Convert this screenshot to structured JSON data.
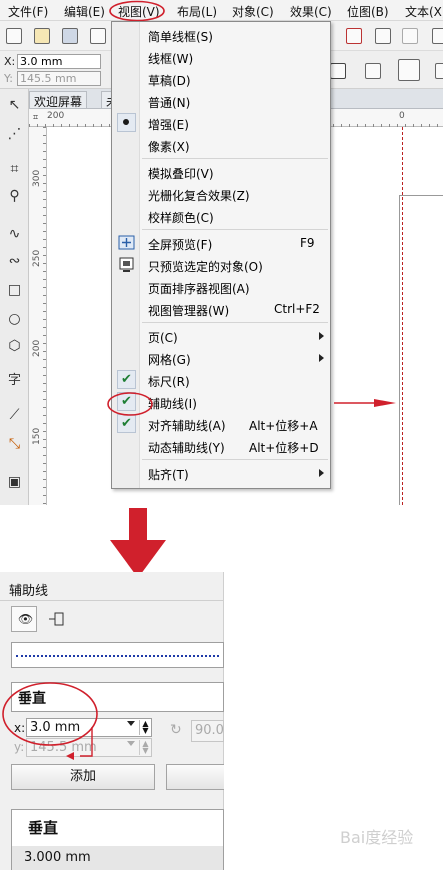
{
  "menubar": {
    "items": [
      "文件(F)",
      "编辑(E)",
      "视图(V)",
      "布局(L)",
      "对象(C)",
      "效果(C)",
      "位图(B)",
      "文本(X)"
    ]
  },
  "property_bar": {
    "x_label": "X:",
    "x_value": "3.0 mm",
    "y_label": "Y:",
    "y_value": "145.5 mm"
  },
  "tabs": {
    "welcome": "欢迎屏幕",
    "untitled": "未"
  },
  "ruler": {
    "h_labels": [
      "200",
      "0"
    ],
    "v_labels": [
      "300",
      "250",
      "200",
      "150"
    ]
  },
  "toolbox": {
    "text_tool": "字"
  },
  "view_menu": {
    "items": [
      {
        "label": "简单线框(S)",
        "shortcut": "",
        "submenu": false,
        "mark": "none"
      },
      {
        "label": "线框(W)",
        "shortcut": "",
        "submenu": false,
        "mark": "none"
      },
      {
        "label": "草稿(D)",
        "shortcut": "",
        "submenu": false,
        "mark": "none"
      },
      {
        "label": "普通(N)",
        "shortcut": "",
        "submenu": false,
        "mark": "none"
      },
      {
        "label": "增强(E)",
        "shortcut": "",
        "submenu": false,
        "mark": "radio"
      },
      {
        "label": "像素(X)",
        "shortcut": "",
        "submenu": false,
        "mark": "none"
      },
      {
        "label": "模拟叠印(V)",
        "shortcut": "",
        "submenu": false,
        "mark": "none"
      },
      {
        "label": "光栅化复合效果(Z)",
        "shortcut": "",
        "submenu": false,
        "mark": "none"
      },
      {
        "label": "校样颜色(C)",
        "shortcut": "",
        "submenu": false,
        "mark": "none"
      },
      {
        "label": "全屏预览(F)",
        "shortcut": "F9",
        "submenu": false,
        "mark": "icon"
      },
      {
        "label": "只预览选定的对象(O)",
        "shortcut": "",
        "submenu": false,
        "mark": "icon"
      },
      {
        "label": "页面排序器视图(A)",
        "shortcut": "",
        "submenu": false,
        "mark": "none"
      },
      {
        "label": "视图管理器(W)",
        "shortcut": "Ctrl+F2",
        "submenu": false,
        "mark": "none"
      },
      {
        "label": "页(C)",
        "shortcut": "",
        "submenu": true,
        "mark": "none"
      },
      {
        "label": "网格(G)",
        "shortcut": "",
        "submenu": true,
        "mark": "none"
      },
      {
        "label": "标尺(R)",
        "shortcut": "",
        "submenu": false,
        "mark": "check"
      },
      {
        "label": "辅助线(I)",
        "shortcut": "",
        "submenu": false,
        "mark": "check"
      },
      {
        "label": "对齐辅助线(A)",
        "shortcut": "Alt+位移+A",
        "submenu": false,
        "mark": "check"
      },
      {
        "label": "动态辅助线(Y)",
        "shortcut": "Alt+位移+D",
        "submenu": false,
        "mark": "none"
      },
      {
        "label": "贴齐(T)",
        "shortcut": "",
        "submenu": true,
        "mark": "none"
      }
    ]
  },
  "guides_panel": {
    "title": "辅助线",
    "orientation_value": "垂直",
    "x_label": "x:",
    "x_value": "3.0 mm",
    "y_label": "y:",
    "y_value": "145.5 mm",
    "angle_value": "90.0",
    "add_button": "添加",
    "list_header": "垂直",
    "list_value": "3.000 mm"
  },
  "watermark": "Bai度经验",
  "colors": {
    "annotation_red": "#d0202c",
    "guide_line_blue": "#1f3aa8",
    "check_green": "#1e7e34"
  }
}
